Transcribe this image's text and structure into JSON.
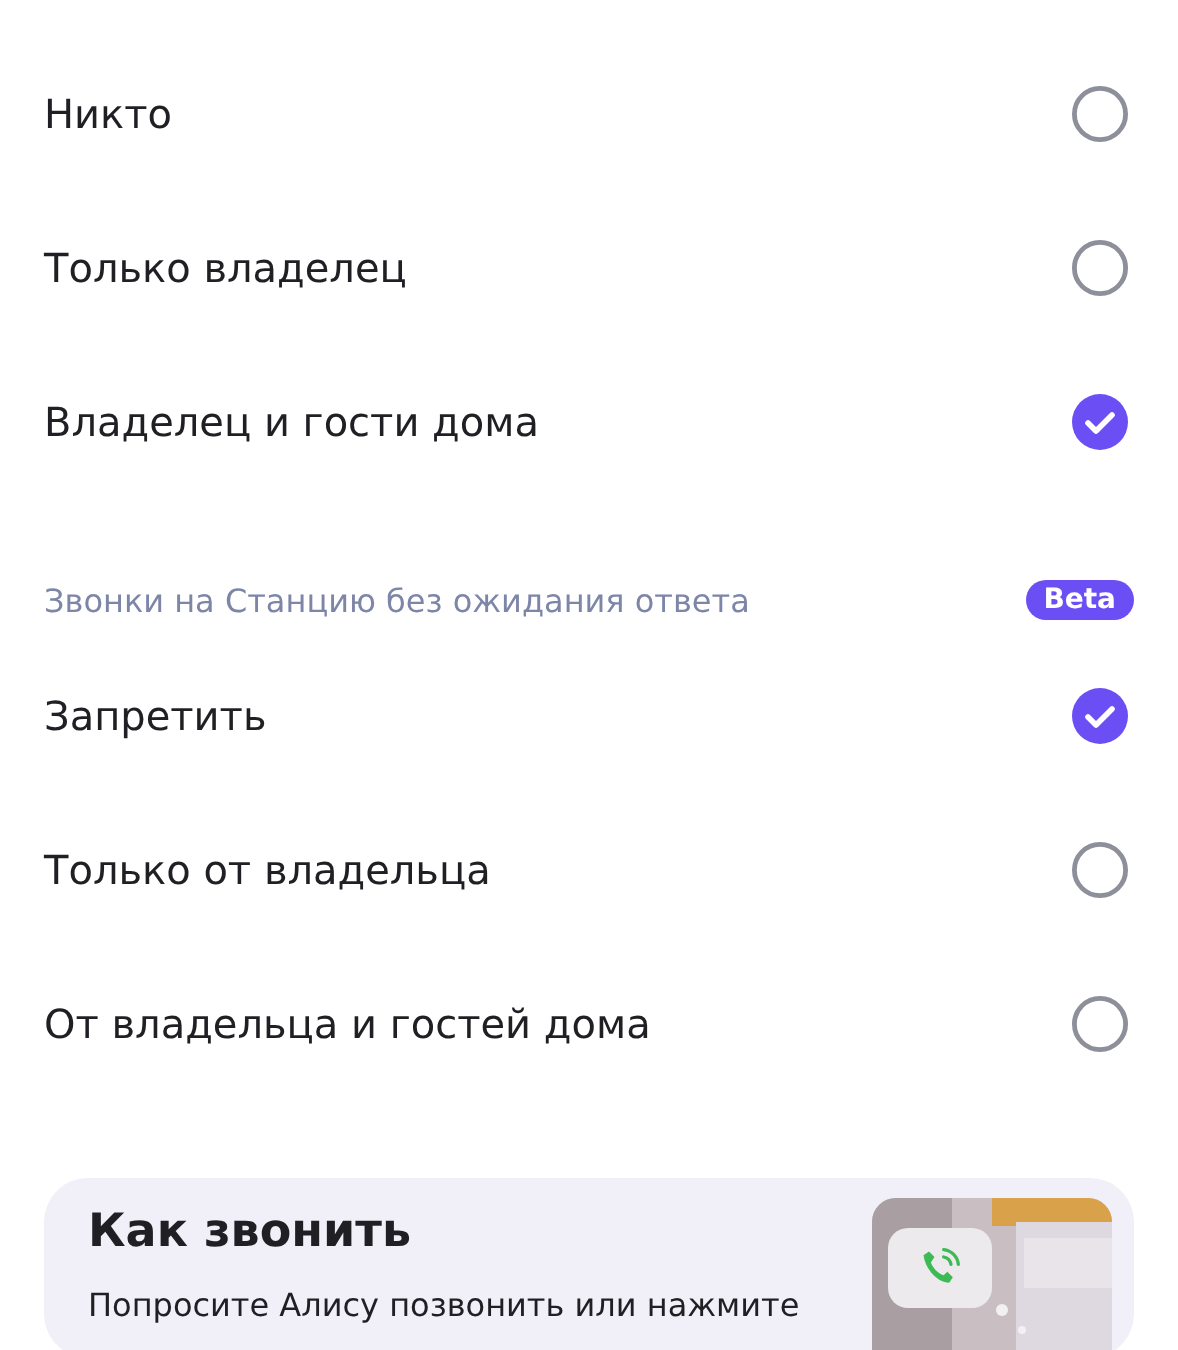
{
  "groups": [
    {
      "options": [
        {
          "label": "Никто",
          "selected": false
        },
        {
          "label": "Только владелец",
          "selected": false
        },
        {
          "label": "Владелец и гости дома",
          "selected": true
        }
      ]
    },
    {
      "title": "Звонки на Станцию без ожидания ответа",
      "badge": "Beta",
      "options": [
        {
          "label": "Запретить",
          "selected": true
        },
        {
          "label": "Только от владельца",
          "selected": false
        },
        {
          "label": "От владельца и гостей дома",
          "selected": false
        }
      ]
    }
  ],
  "card": {
    "title": "Как звонить",
    "text": "Попросите Алису позвонить или нажмите"
  }
}
